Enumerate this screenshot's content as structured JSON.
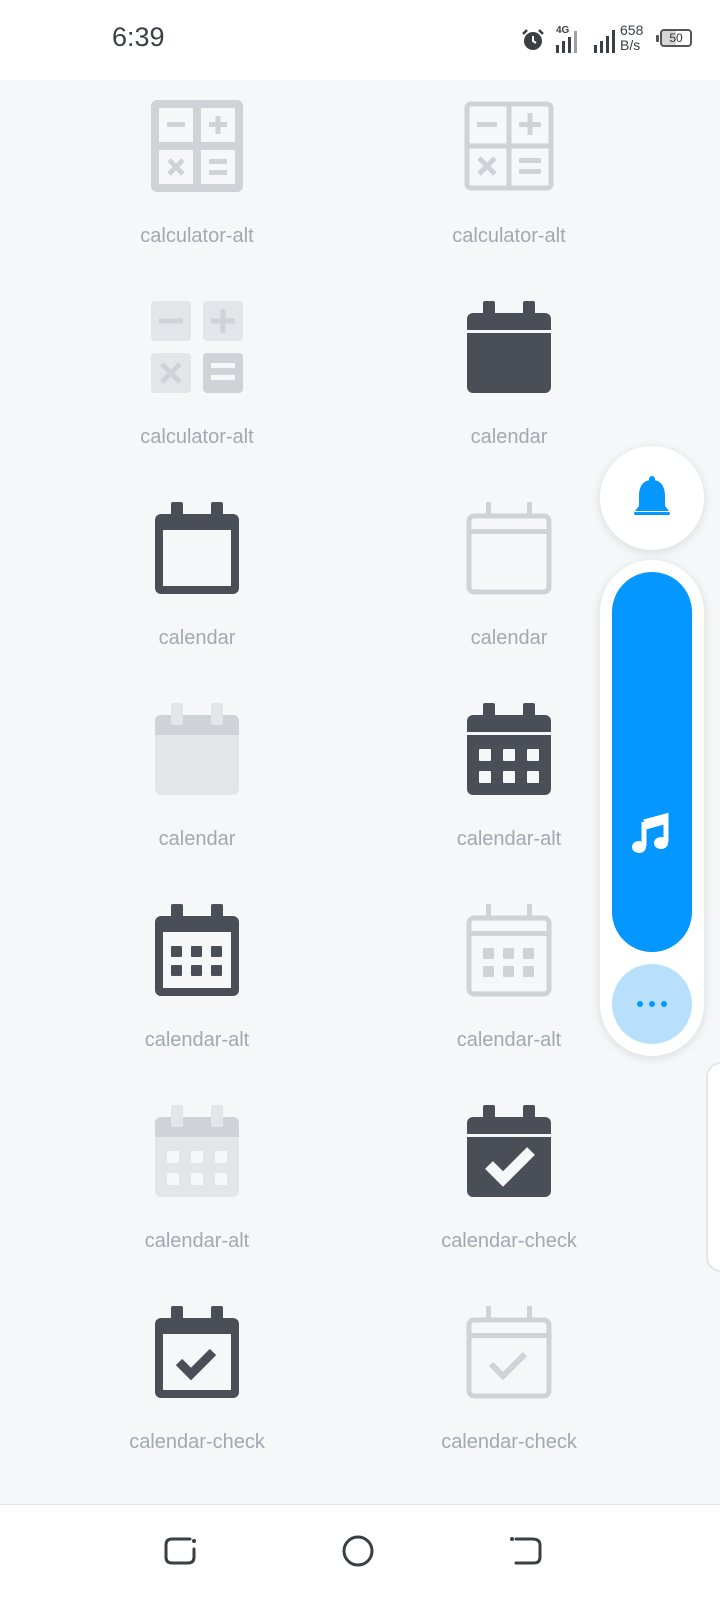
{
  "status_bar": {
    "time": "6:39",
    "network_type": "4G",
    "speed_value": "658",
    "speed_unit": "B/s",
    "battery_level": "50",
    "icons": [
      "alarm-icon",
      "signal-4g-icon",
      "signal-icon",
      "battery-icon"
    ]
  },
  "icons": [
    {
      "label": "calculator-alt",
      "icon": "calculator-alt-icon"
    },
    {
      "label": "calculator-alt",
      "icon": "calculator-alt-icon"
    },
    {
      "label": "calculator-alt",
      "icon": "calculator-alt-icon"
    },
    {
      "label": "calendar",
      "icon": "calendar-icon"
    },
    {
      "label": "calendar",
      "icon": "calendar-icon"
    },
    {
      "label": "calendar",
      "icon": "calendar-icon"
    },
    {
      "label": "calendar",
      "icon": "calendar-icon"
    },
    {
      "label": "calendar-alt",
      "icon": "calendar-alt-icon"
    },
    {
      "label": "calendar-alt",
      "icon": "calendar-alt-icon"
    },
    {
      "label": "calendar-alt",
      "icon": "calendar-alt-icon"
    },
    {
      "label": "calendar-alt",
      "icon": "calendar-alt-icon"
    },
    {
      "label": "calendar-check",
      "icon": "calendar-check-icon"
    },
    {
      "label": "calendar-check",
      "icon": "calendar-check-icon"
    },
    {
      "label": "calendar-check",
      "icon": "calendar-check-icon"
    }
  ],
  "floating_panel": {
    "bell_icon": "bell-icon",
    "music_icon": "music-note-icon",
    "more_icon": "more-horizontal-icon"
  },
  "colors": {
    "dark_icon": "#4a4f57",
    "light_icon": "#cfd3d8",
    "lighter_icon": "#e3e5e8",
    "accent_blue": "#0497ff",
    "accent_light_blue": "#b8e0fb",
    "label": "#a3a8b0"
  },
  "nav_bar": {
    "buttons": [
      "recent-apps-button",
      "home-button",
      "back-button"
    ]
  }
}
